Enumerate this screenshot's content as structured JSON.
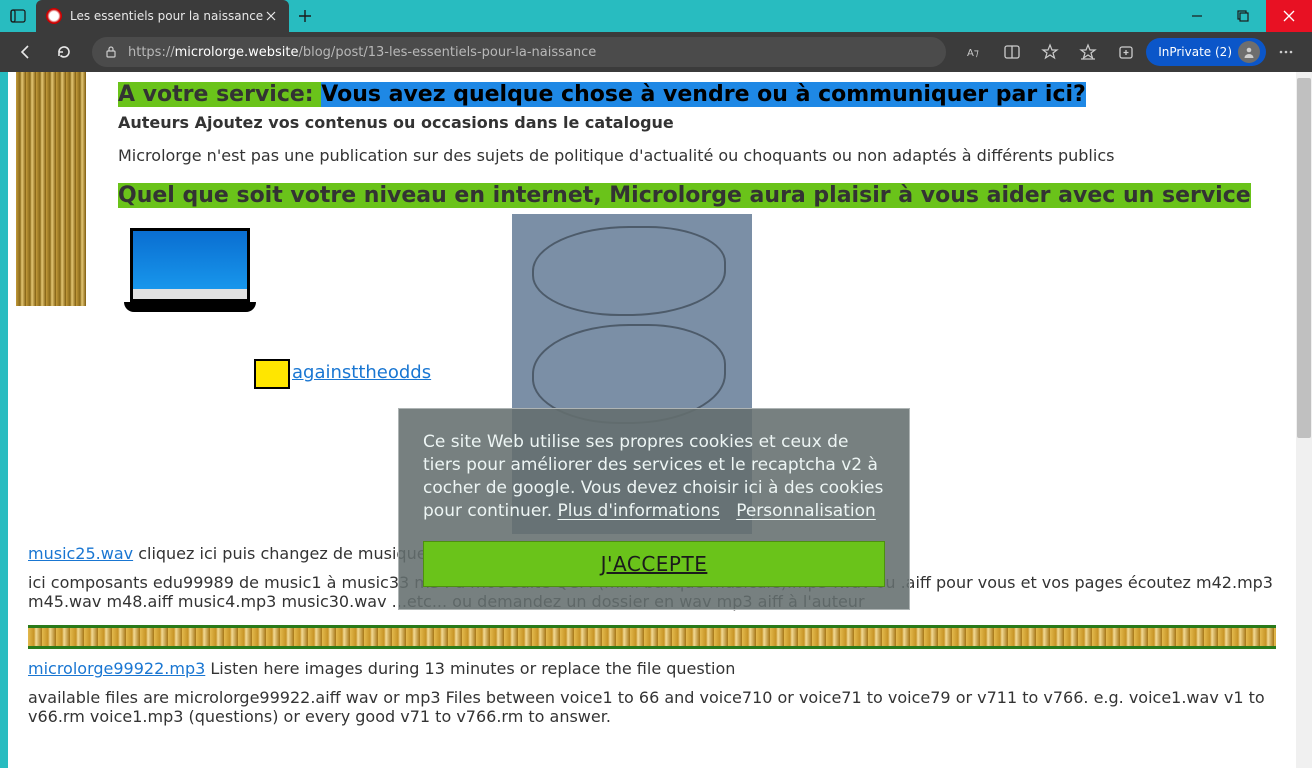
{
  "browser": {
    "tab_title": "Les essentiels pour la naissance",
    "url_host": "microlorge.website",
    "url_prefix": "https://",
    "url_path": "/blog/post/13-les-essentiels-pour-la-naissance",
    "inprivate_label": "InPrivate (2)"
  },
  "page": {
    "service_prefix": "A votre service: ",
    "service_highlight": "Vous avez quelque chose à vendre ou à communiquer par ici?",
    "authors_line": "Auteurs Ajoutez vos contenus ou occasions dans le catalogue",
    "disclaimer": "Microlorge n'est pas une publication sur des sujets de politique   d'actualité ou choquants ou non adaptés à différents publics",
    "level_headline": "Quel que soit votre niveau en internet, Microlorge aura plaisir à vous aider avec un service",
    "odds_link": "againsttheodds",
    "music_link": "music25.wav",
    "music_text": " cliquez ici puis changez de musique et d'extension",
    "components_text": "ici composants edu99989 de music1 à music33 m34 à m66 suite QCM (mini banque musicale).mp3 .wav ou .aiff pour vous et vos pages écoutez m42.mp3 m45.wav m48.aiff music4.mp3 music30.wav ...etc... ou demandez un dossier en wav mp3 aiff à l'auteur",
    "micro_link": "microlorge99922.mp3",
    "micro_text": " Listen here images during 13 minutes or replace the file question",
    "available_text": "available files are microlorge99922.aiff wav or mp3 Files between voice1 to 66 and voice710 or voice71 to voice79 or v711 to v766. e.g. voice1.wav v1 to v66.rm voice1.mp3 (questions) or every good v71 to v766.rm to answer."
  },
  "cookie": {
    "text_main": "Ce site Web utilise ses propres cookies et ceux de tiers pour améliorer des services et le recaptcha v2 à cocher de google. Vous devez choisir ici à des cookies pour continuer.  ",
    "more_info": "Plus d'informations",
    "personalize": "Personnalisation",
    "accept": "J'ACCEPTE"
  }
}
